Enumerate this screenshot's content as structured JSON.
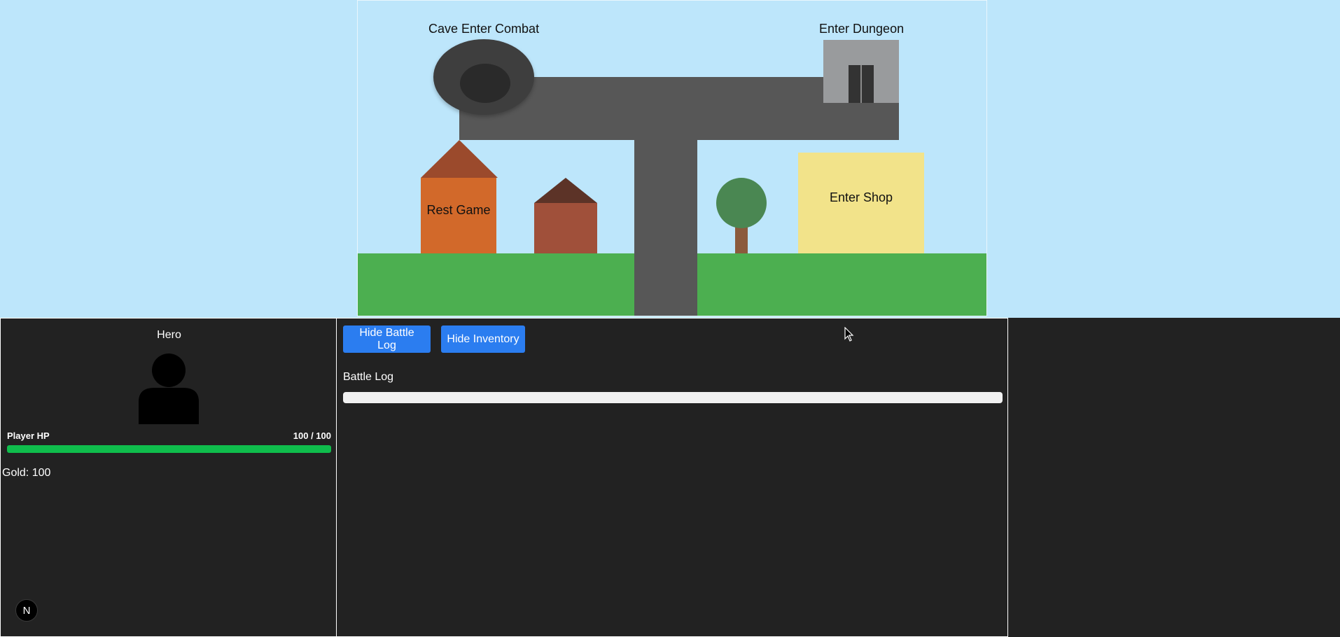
{
  "scene": {
    "cave_label": "Cave Enter Combat",
    "dungeon_label": "Enter Dungeon",
    "rest_label": "Rest Game",
    "shop_label": "Enter Shop"
  },
  "player": {
    "name": "Hero",
    "avatar_icon": "user-silhouette-icon",
    "hp_label": "Player HP",
    "hp_text": "100 / 100",
    "hp_current": 100,
    "hp_max": 100,
    "hp_color": "#0fbd4c",
    "gold_text": "Gold: 100",
    "badge": "N"
  },
  "controls": {
    "battle_log_button": "Hide Battle Log",
    "inventory_button": "Hide Inventory",
    "button_color": "#2b7df0"
  },
  "battle_log": {
    "title": "Battle Log",
    "entries": []
  }
}
